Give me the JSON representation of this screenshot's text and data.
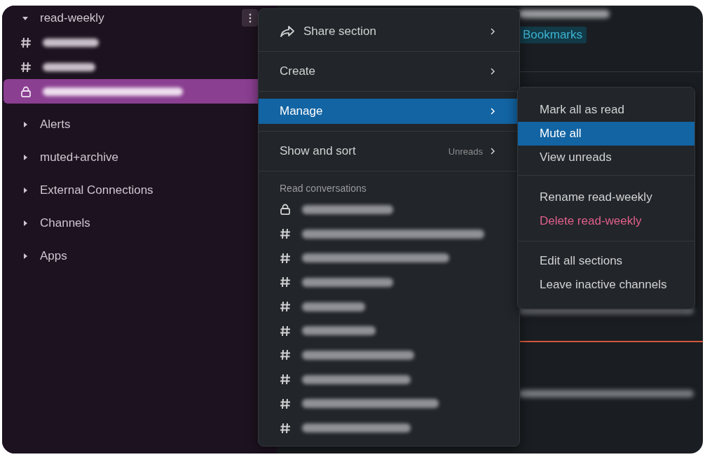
{
  "sidebar": {
    "sections": [
      {
        "label": "read-weekly",
        "expanded": true,
        "channels": [
          {
            "kind": "hash",
            "selected": false
          },
          {
            "kind": "hash",
            "selected": false
          },
          {
            "kind": "lock",
            "selected": true
          }
        ]
      },
      {
        "label": "Alerts",
        "expanded": false
      },
      {
        "label": "muted+archive",
        "expanded": false
      },
      {
        "label": "External Connections",
        "expanded": false
      },
      {
        "label": "Channels",
        "expanded": false
      },
      {
        "label": "Apps",
        "expanded": false
      }
    ]
  },
  "main": {
    "bookmarks_tab": "Bookmarks"
  },
  "menu": {
    "groups": [
      [
        {
          "kind": "share",
          "label": "Share section",
          "submenu": true,
          "selected": false
        }
      ],
      [
        {
          "kind": "item",
          "label": "Create",
          "submenu": true,
          "selected": false
        }
      ],
      [
        {
          "kind": "item",
          "label": "Manage",
          "submenu": true,
          "selected": true
        }
      ],
      [
        {
          "kind": "item",
          "label": "Show and sort",
          "hint": "Unreads",
          "submenu": true,
          "selected": false
        }
      ]
    ],
    "read_conversations": {
      "heading": "Read conversations",
      "items": [
        {
          "kind": "lock"
        },
        {
          "kind": "hash"
        },
        {
          "kind": "hash"
        },
        {
          "kind": "hash"
        },
        {
          "kind": "hash"
        },
        {
          "kind": "hash"
        },
        {
          "kind": "hash"
        },
        {
          "kind": "hash"
        },
        {
          "kind": "hash"
        },
        {
          "kind": "hash"
        }
      ]
    }
  },
  "submenu": {
    "groups": [
      [
        {
          "kind": "item",
          "label": "Mark all as read",
          "selected": false
        },
        {
          "kind": "item",
          "label": "Mute all",
          "selected": true
        },
        {
          "kind": "item",
          "label": "View unreads",
          "selected": false
        }
      ],
      [
        {
          "kind": "item",
          "label": "Rename read-weekly",
          "selected": false
        },
        {
          "kind": "danger",
          "label": "Delete read-weekly",
          "selected": false
        }
      ],
      [
        {
          "kind": "item",
          "label": "Edit all sections",
          "selected": false
        },
        {
          "kind": "item",
          "label": "Leave inactive channels",
          "selected": false
        }
      ]
    ]
  }
}
